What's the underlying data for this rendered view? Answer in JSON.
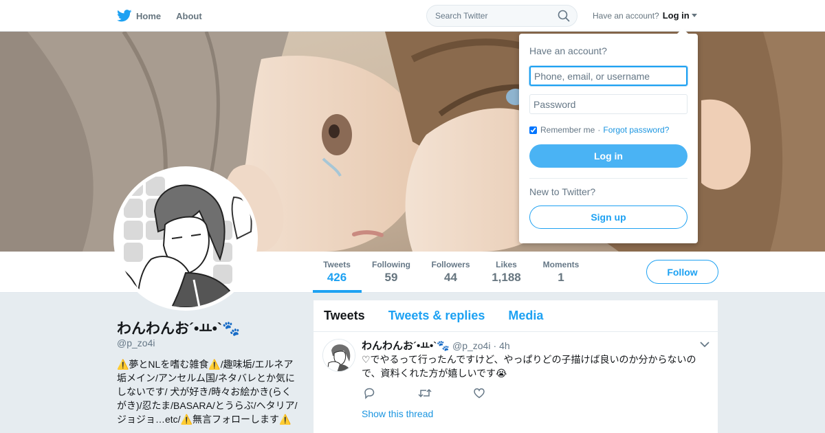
{
  "nav": {
    "home_label": "Home",
    "about_label": "About",
    "search_placeholder": "Search Twitter",
    "have_account_text": "Have an account?",
    "login_label": "Log in"
  },
  "profile": {
    "name": "わんわんお´•ㅛ•`🐾",
    "handle": "@p_zo4i",
    "bio": "⚠️夢とNLを嗜む雑食⚠️/趣味垢/エルネア垢メイン/アンセルム国/ネタバレとか気にしないです/ 犬が好き/時々お絵かき(らくがき)/忍たま/BASARA/とうらぶ/ヘタリア/ジョジョ…etc/⚠️無言フォローします⚠️"
  },
  "stats": [
    {
      "label": "Tweets",
      "value": "426"
    },
    {
      "label": "Following",
      "value": "59"
    },
    {
      "label": "Followers",
      "value": "44"
    },
    {
      "label": "Likes",
      "value": "1,188"
    },
    {
      "label": "Moments",
      "value": "1"
    }
  ],
  "follow_label": "Follow",
  "timeline": {
    "tabs": [
      "Tweets",
      "Tweets & replies",
      "Media"
    ],
    "tweet": {
      "name": "わんわんお´•ㅛ•`🐾",
      "handle": "@p_zo4i",
      "sep": "·",
      "time": "4h",
      "text": "♡でやるって行ったんですけど、やっぱりどの子描けば良いのか分からないので、資料くれた方が嬉しいです😭",
      "show_thread": "Show this thread"
    }
  },
  "login_dropdown": {
    "title": "Have an account?",
    "username_placeholder": "Phone, email, or username",
    "password_placeholder": "Password",
    "remember_label": "Remember me",
    "dot": "·",
    "forgot_label": "Forgot password?",
    "login_button": "Log in",
    "new_label": "New to Twitter?",
    "signup_button": "Sign up"
  },
  "colors": {
    "accent": "#1da1f2",
    "login_button": "#4ab3f4",
    "page_bg": "#e6ecf0"
  },
  "icons": [
    "twitter-bird-icon",
    "home-icon",
    "search-icon",
    "reply-icon",
    "retweet-icon",
    "like-icon",
    "chevron-down-icon"
  ]
}
